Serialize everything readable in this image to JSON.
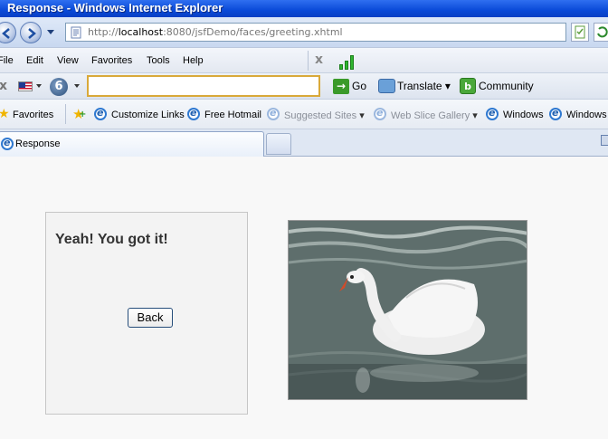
{
  "window": {
    "title": "Response - Windows Internet Explorer"
  },
  "address": {
    "url_prefix": "http://",
    "url_host": "localhost",
    "url_rest": ":8080/jsfDemo/faces/greeting.xhtml"
  },
  "menu": {
    "items": [
      "File",
      "Edit",
      "View",
      "Favorites",
      "Tools",
      "Help"
    ]
  },
  "toolbar": {
    "search_value": "",
    "go_label": "Go",
    "translate_label": "Translate",
    "community_label": "Community"
  },
  "favorites": {
    "label": "Favorites",
    "links": [
      {
        "label": "Customize Links",
        "enabled": true
      },
      {
        "label": "Free Hotmail",
        "enabled": true
      },
      {
        "label": "Suggested Sites",
        "enabled": false
      },
      {
        "label": "Web Slice Gallery",
        "enabled": false
      },
      {
        "label": "Windows",
        "enabled": true
      },
      {
        "label": "Windows",
        "enabled": true
      }
    ]
  },
  "tabs": [
    {
      "label": "Response",
      "active": true
    }
  ],
  "page": {
    "message": "Yeah! You got it!",
    "back_label": "Back",
    "image": {
      "subject": "white swan swimming on dark rippled water"
    }
  },
  "colors": {
    "titlebar": "#0a4ad8",
    "button_border": "#264d7a",
    "panel_bg": "#f3f3f3",
    "search_border": "#d9a93a"
  }
}
